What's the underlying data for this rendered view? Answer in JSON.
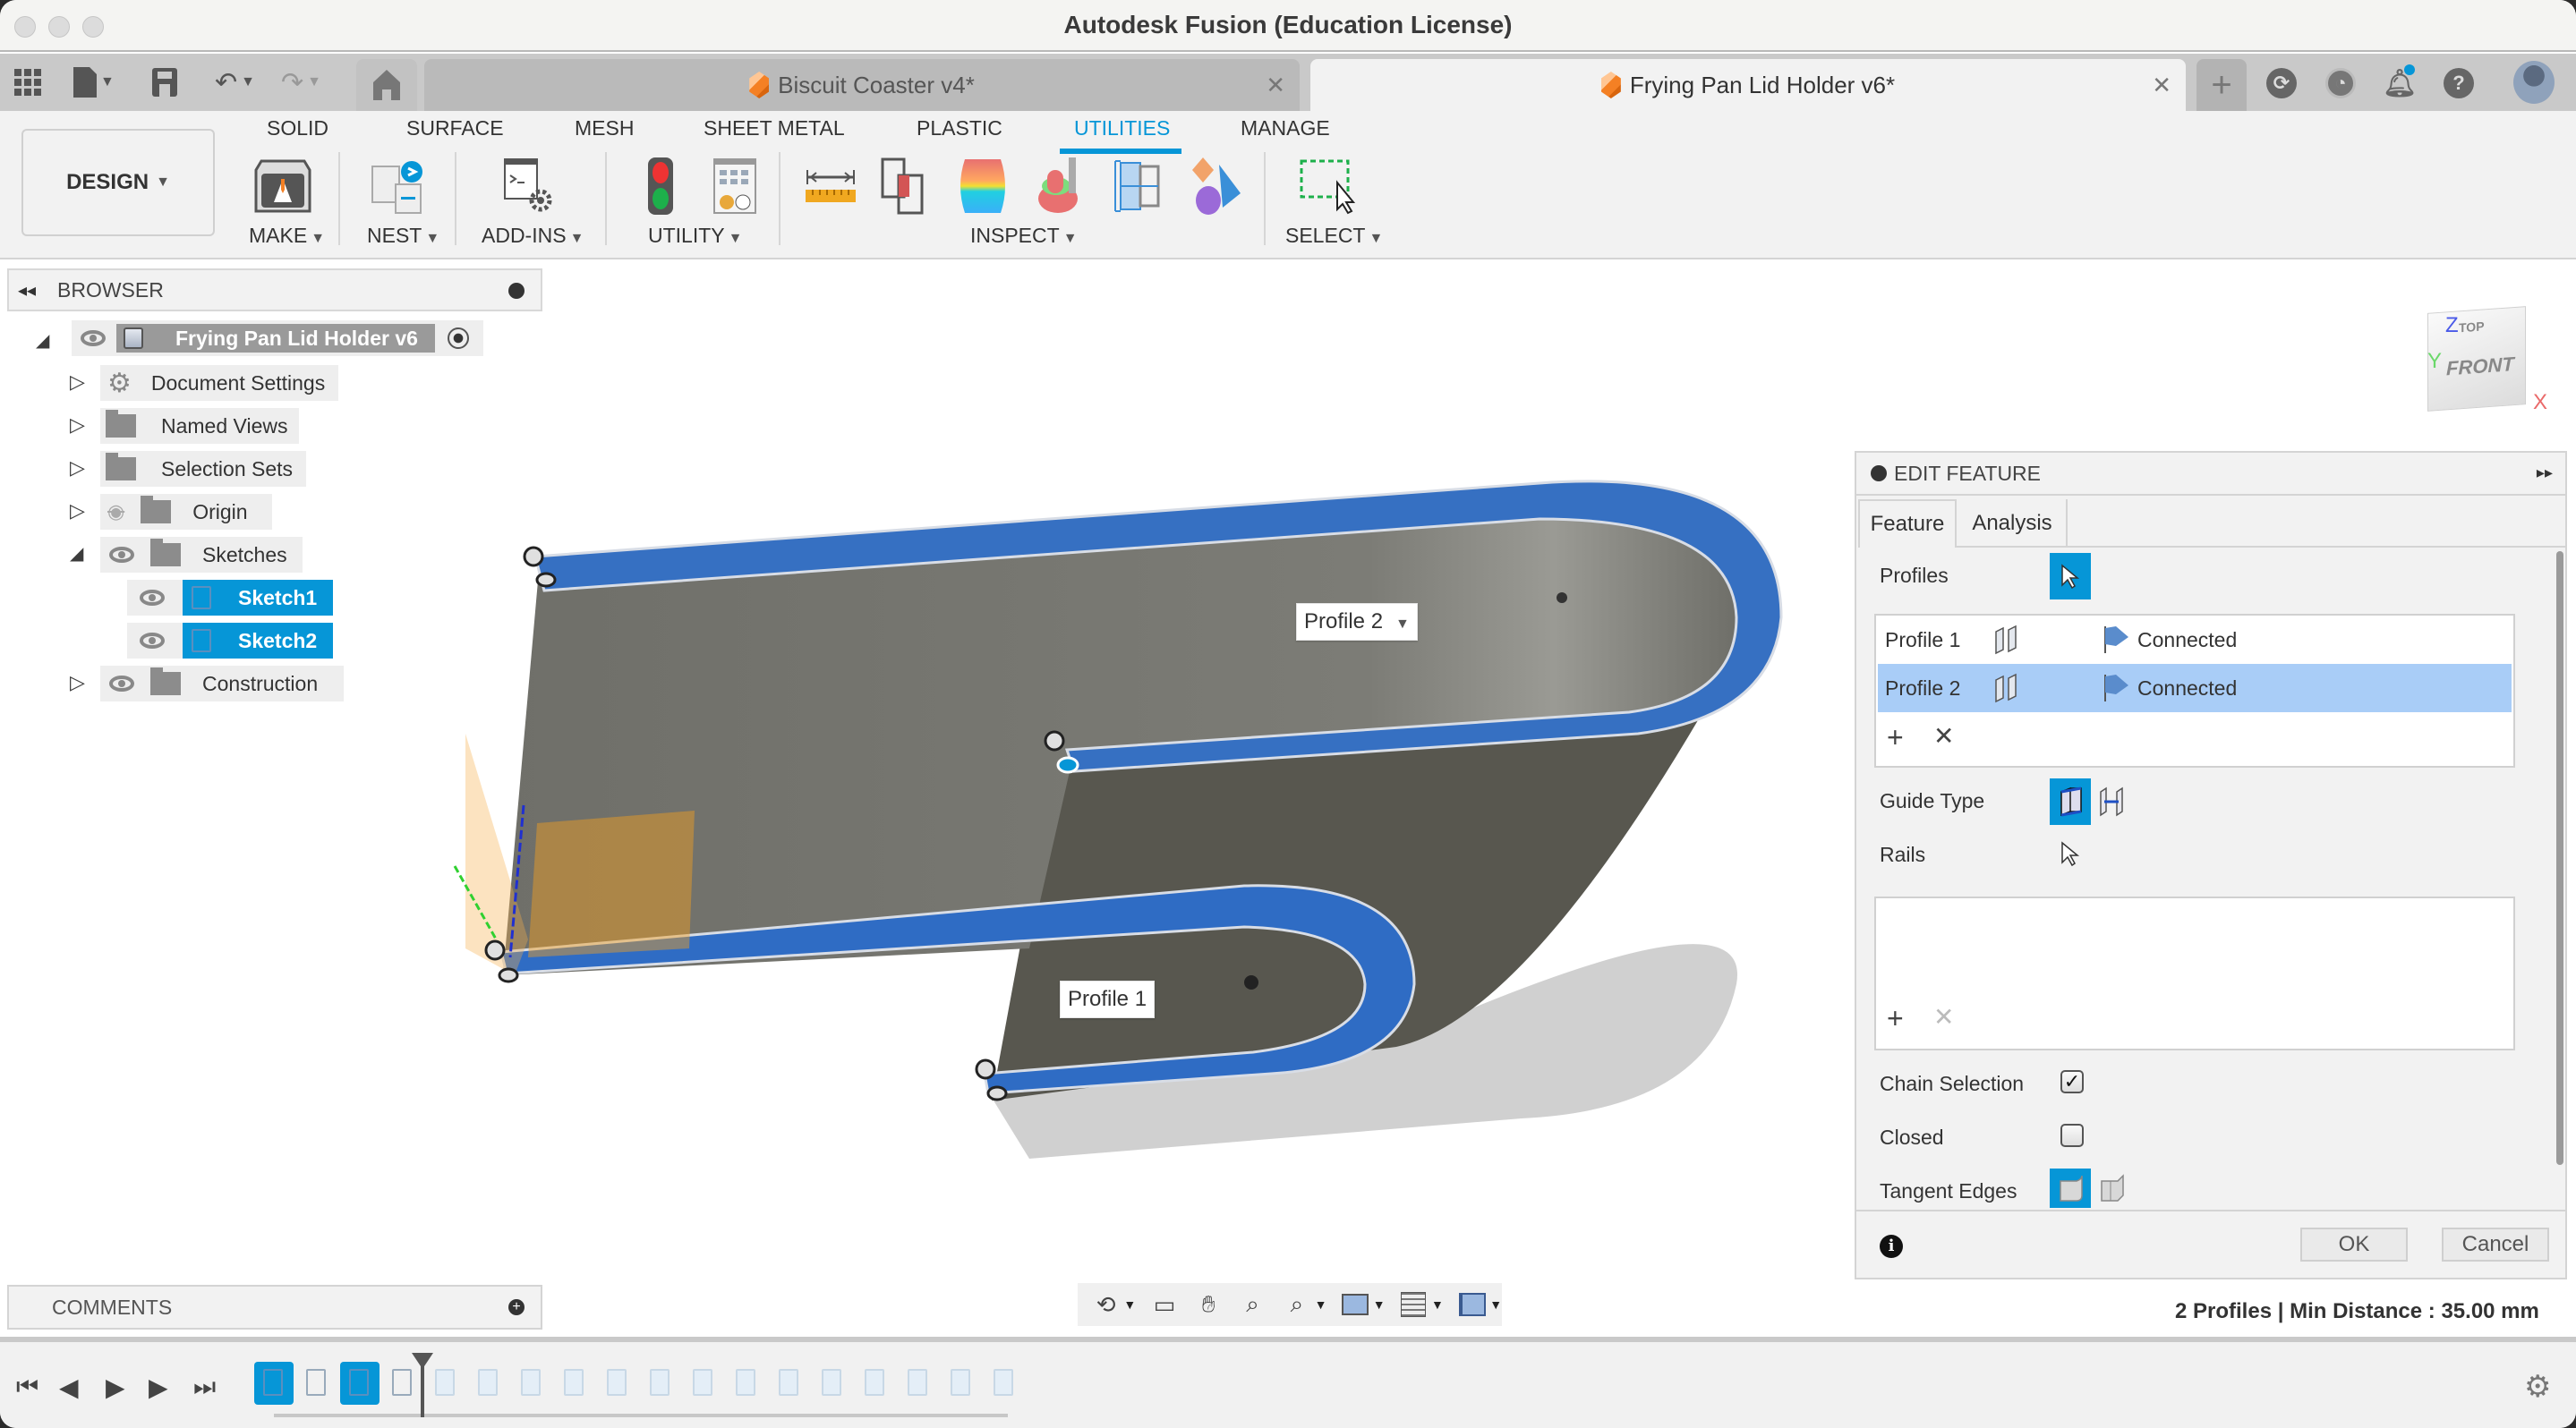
{
  "window": {
    "title": "Autodesk Fusion (Education License)"
  },
  "tabs": [
    {
      "label": "Biscuit Coaster v4*",
      "active": false
    },
    {
      "label": "Frying Pan Lid Holder v6*",
      "active": true
    }
  ],
  "quick_access": {
    "icons": [
      "app-grid-icon",
      "file-icon",
      "save-icon",
      "undo-icon",
      "redo-icon",
      "home-icon"
    ],
    "right_icons": [
      "extensions-icon",
      "job-status-icon",
      "notifications-icon",
      "help-icon",
      "profile-avatar"
    ]
  },
  "ribbon": {
    "workspace": "DESIGN",
    "tabs": [
      "SOLID",
      "SURFACE",
      "MESH",
      "SHEET METAL",
      "PLASTIC",
      "UTILITIES",
      "MANAGE"
    ],
    "active_tab": "UTILITIES",
    "groups": [
      {
        "label": "MAKE",
        "icons": [
          "3d-print-icon"
        ]
      },
      {
        "label": "NEST",
        "icons": [
          "nest-icon"
        ]
      },
      {
        "label": "ADD-INS",
        "icons": [
          "scripts-addins-icon"
        ]
      },
      {
        "label": "UTILITY",
        "icons": [
          "traffic-light-icon",
          "table-icon"
        ]
      },
      {
        "label": "INSPECT",
        "icons": [
          "measure-icon",
          "interference-icon",
          "curvature-analysis-icon",
          "accessibility-icon",
          "section-analysis-icon",
          "component-color-icon"
        ]
      },
      {
        "label": "SELECT",
        "icons": [
          "window-select-icon"
        ]
      }
    ]
  },
  "browser": {
    "title": "BROWSER",
    "root": "Frying Pan Lid Holder v6",
    "items": [
      {
        "label": "Document Settings",
        "icon": "gear-icon",
        "expanded": false
      },
      {
        "label": "Named Views",
        "icon": "folder-icon",
        "expanded": false
      },
      {
        "label": "Selection Sets",
        "icon": "folder-icon",
        "expanded": false
      },
      {
        "label": "Origin",
        "icon": "folder-icon",
        "expanded": false,
        "visible": false
      },
      {
        "label": "Sketches",
        "icon": "folder-icon",
        "expanded": true,
        "visible": true
      },
      {
        "label": "Construction",
        "icon": "folder-icon",
        "expanded": false,
        "visible": true
      }
    ],
    "sketches": [
      {
        "label": "Sketch1",
        "selected": true
      },
      {
        "label": "Sketch2",
        "selected": true
      }
    ]
  },
  "viewport": {
    "labels": {
      "profile2": "Profile 2",
      "profile1": "Profile 1"
    },
    "viewcube": {
      "top": "TOP",
      "front": "FRONT",
      "x": "X",
      "y": "Y",
      "z": "Z"
    }
  },
  "edit_feature": {
    "title": "EDIT FEATURE",
    "tabs": [
      "Feature",
      "Analysis"
    ],
    "active_tab": "Feature",
    "profiles_label": "Profiles",
    "profiles": [
      {
        "name": "Profile 1",
        "status": "Connected",
        "selected": false
      },
      {
        "name": "Profile 2",
        "status": "Connected",
        "selected": true
      }
    ],
    "guide_type_label": "Guide Type",
    "guide_type_selected": "rails",
    "rails_label": "Rails",
    "chain_selection_label": "Chain Selection",
    "chain_selection": true,
    "closed_label": "Closed",
    "closed": false,
    "tangent_edges_label": "Tangent Edges",
    "tangent_edges_selected": "merge",
    "ok_label": "OK",
    "cancel_label": "Cancel"
  },
  "status_bar": {
    "text": "2 Profiles | Min Distance : 35.00 mm"
  },
  "comments": {
    "title": "COMMENTS"
  },
  "navbar": {
    "icons": [
      "orbit-icon",
      "look-at-icon",
      "pan-icon",
      "zoom-icon",
      "zoom-window-icon",
      "display-settings-icon",
      "grid-icon",
      "viewports-icon"
    ]
  },
  "timeline": {
    "controls": [
      "first-icon",
      "previous-icon",
      "play-icon",
      "next-icon",
      "last-icon"
    ],
    "item_count": 18,
    "active_items": [
      0,
      2
    ],
    "marker_after_item": 3
  },
  "colors": {
    "accent": "#0696d7",
    "profile_edge": "#2f6cc4",
    "selection_row": "#a9cdf7"
  }
}
